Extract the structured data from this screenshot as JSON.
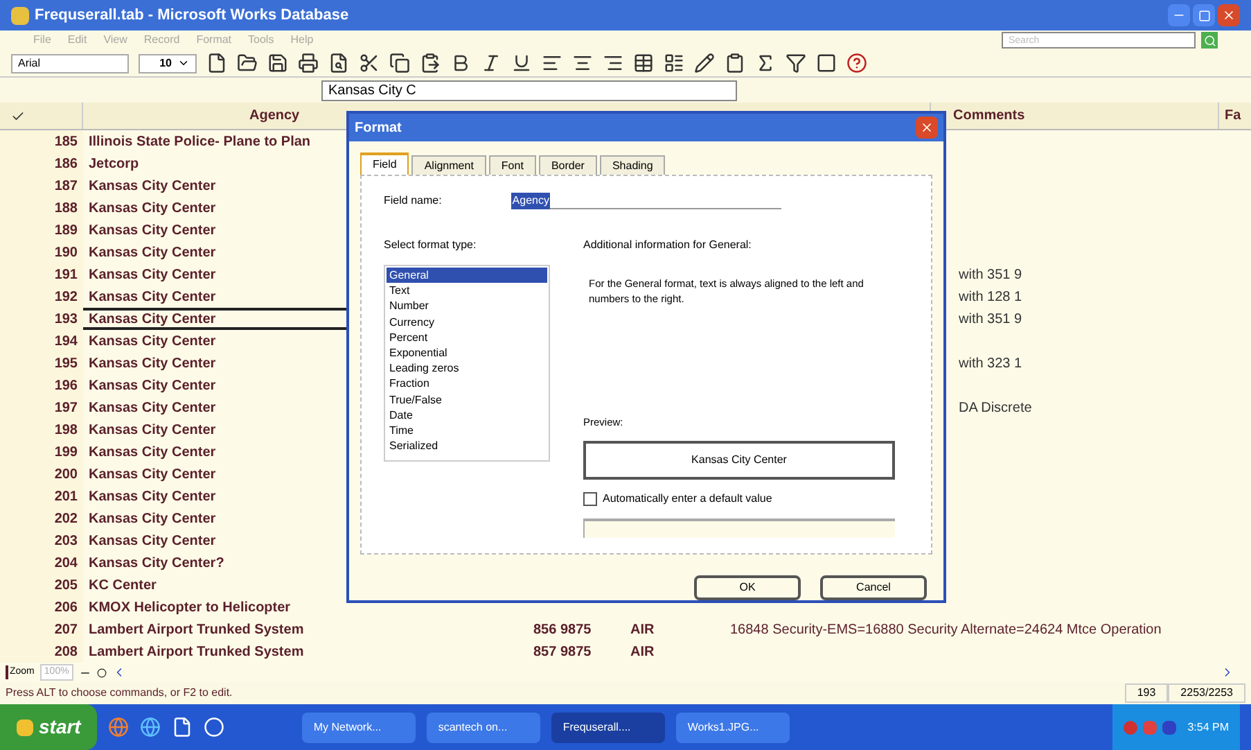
{
  "window": {
    "title": "Frequserall.tab - Microsoft Works Database"
  },
  "menu": [
    "File",
    "Edit",
    "View",
    "Record",
    "Format",
    "Tools",
    "Help"
  ],
  "search": {
    "placeholder": "Search"
  },
  "toolbar": {
    "font": "Arial",
    "size": "10"
  },
  "entry_bar": {
    "value": "Kansas City C"
  },
  "table": {
    "columns": [
      "Agency",
      "Comments",
      "Fa"
    ],
    "rows": [
      {
        "number": "185",
        "agency": "Illinois State Police- Plane to Plan",
        "selected": false
      },
      {
        "number": "186",
        "agency": "Jetcorp",
        "selected": false
      },
      {
        "number": "187",
        "agency": "Kansas City Center",
        "selected": false
      },
      {
        "number": "188",
        "agency": "Kansas City Center",
        "selected": false
      },
      {
        "number": "189",
        "agency": "Kansas City Center",
        "selected": false
      },
      {
        "number": "190",
        "agency": "Kansas City Center",
        "selected": false
      },
      {
        "number": "191",
        "agency": "Kansas City Center",
        "comments": "with 351 9",
        "selected": false
      },
      {
        "number": "192",
        "agency": "Kansas City Center",
        "comments": "with 128 1",
        "selected": false
      },
      {
        "number": "193",
        "agency": "Kansas City Center",
        "comments": "with 351 9",
        "selected": true
      },
      {
        "number": "194",
        "agency": "Kansas City Center",
        "selected": false
      },
      {
        "number": "195",
        "agency": "Kansas City Center",
        "comments": "with 323 1",
        "selected": false
      },
      {
        "number": "196",
        "agency": "Kansas City Center",
        "selected": false
      },
      {
        "number": "197",
        "agency": "Kansas City Center",
        "comments": "DA Discrete",
        "selected": false
      },
      {
        "number": "198",
        "agency": "Kansas City Center",
        "selected": false
      },
      {
        "number": "199",
        "agency": "Kansas City Center",
        "selected": false
      },
      {
        "number": "200",
        "agency": "Kansas City Center",
        "selected": false
      },
      {
        "number": "201",
        "agency": "Kansas City Center",
        "selected": false
      },
      {
        "number": "202",
        "agency": "Kansas City Center",
        "selected": false
      },
      {
        "number": "203",
        "agency": "Kansas City Center",
        "selected": false
      },
      {
        "number": "204",
        "agency": "Kansas City Center?",
        "selected": false
      },
      {
        "number": "205",
        "agency": "KC Center",
        "selected": false
      },
      {
        "number": "206",
        "agency": "KMOX Helicopter to Helicopter",
        "selected": false
      },
      {
        "number": "207",
        "agency": "Lambert Airport Trunked System",
        "frequency": "856 9875",
        "mode": "AIR",
        "column_5": "16848 Security-EMS=16880 Security Alternate=24624 Mtce  Operation",
        "selected": false
      },
      {
        "number": "208",
        "agency": "Lambert Airport Trunked System",
        "frequency": "857 9875",
        "mode": "AIR",
        "selected": false
      }
    ]
  },
  "zoom": {
    "label": "Zoom",
    "value": "100%"
  },
  "status_bar": {
    "message": "Press ALT to choose commands, or F2 to edit.",
    "record": "193",
    "count": "2253/2253"
  },
  "dialog": {
    "title": "Format",
    "tabs": [
      {
        "label": "Field",
        "selected": true
      },
      {
        "label": "Alignment",
        "selected": false
      },
      {
        "label": "Font",
        "selected": false
      },
      {
        "label": "Border",
        "selected": false
      },
      {
        "label": "Shading",
        "selected": false
      }
    ],
    "field_name_label": "Field name:",
    "field_name": "Agency",
    "format_type_label": "Select format type:",
    "format_types": [
      {
        "label": "General",
        "selected": true
      },
      {
        "label": "Text",
        "selected": false
      },
      {
        "label": "Number",
        "selected": false
      },
      {
        "label": "Currency",
        "selected": false
      },
      {
        "label": "Percent",
        "selected": false
      },
      {
        "label": "Exponential",
        "selected": false
      },
      {
        "label": "Leading zeros",
        "selected": false
      },
      {
        "label": "Fraction",
        "selected": false
      },
      {
        "label": "True/False",
        "selected": false
      },
      {
        "label": "Date",
        "selected": false
      },
      {
        "label": "Time",
        "selected": false
      },
      {
        "label": "Serialized",
        "selected": false
      }
    ],
    "info_label": "Additional information for General:",
    "info_text": "For the General format, text is always aligned to the left and numbers to the right.",
    "preview_label": "Preview:",
    "preview": "Kansas City Center",
    "default_value": {
      "label": "Automatically enter a default value",
      "checked": false
    },
    "buttons": [
      "OK",
      "Cancel"
    ]
  },
  "taskbar": {
    "start": "start",
    "tasks": [
      {
        "label": "My Network...",
        "selected": false
      },
      {
        "label": "scantech on...",
        "selected": false
      },
      {
        "label": "Frequserall....",
        "selected": true
      },
      {
        "label": "Works1.JPG...",
        "selected": false
      }
    ],
    "clock": "3:54 PM"
  }
}
